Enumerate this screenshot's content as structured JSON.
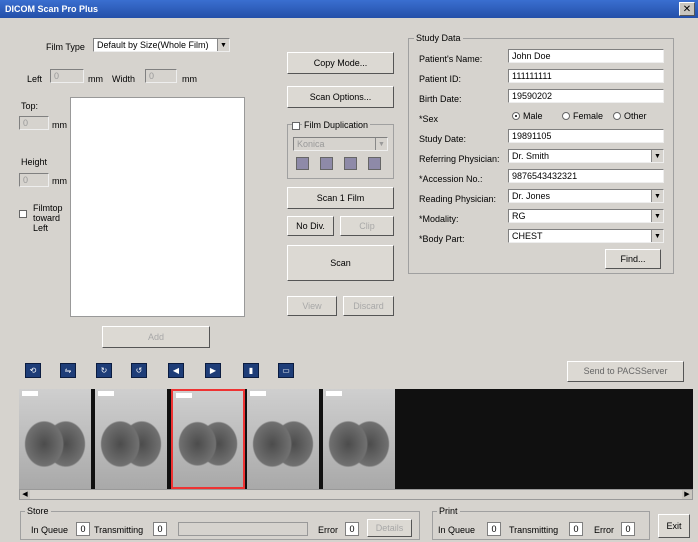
{
  "window": {
    "title": "DICOM Scan Pro Plus",
    "close_glyph": "✕"
  },
  "scan": {
    "film_type_label": "Film Type",
    "film_type_value": "Default by Size(Whole Film)",
    "left_label": "Left",
    "left_value": "0",
    "mm1": "mm",
    "width_label": "Width",
    "width_value": "0",
    "mm2": "mm",
    "top_label": "Top:",
    "top_value": "0",
    "mm3": "mm",
    "height_label": "Height",
    "height_value": "0",
    "mm4": "mm",
    "filmtop_label_1": "Filmtop",
    "filmtop_label_2": "toward",
    "filmtop_label_3": "Left",
    "add_label": "Add"
  },
  "middle": {
    "copy_mode": "Copy Mode...",
    "scan_options": "Scan Options...",
    "film_dup_label": "Film Duplication",
    "film_dup_combo": "Konica",
    "scan_1_film": "Scan 1 Film",
    "no_div": "No Div.",
    "clip": "Clip",
    "scan": "Scan",
    "view": "View",
    "discard": "Discard"
  },
  "study": {
    "group_label": "Study Data",
    "patient_name_label": "Patient's Name:",
    "patient_name": "John Doe",
    "patient_id_label": "Patient ID:",
    "patient_id": "111111111",
    "birth_date_label": "Birth Date:",
    "birth_date": "19590202",
    "sex_label": "*Sex",
    "male": "Male",
    "female": "Female",
    "other": "Other",
    "study_date_label": "Study Date:",
    "study_date": "19891105",
    "ref_phys_label": "Referring Physician:",
    "ref_phys": "Dr. Smith",
    "accession_label": "*Accession No.:",
    "accession": "9876543432321",
    "read_phys_label": "Reading Physician:",
    "read_phys": "Dr. Jones",
    "modality_label": "*Modality:",
    "modality": "RG",
    "body_part_label": "*Body Part:",
    "body_part": "CHEST",
    "find": "Find..."
  },
  "toolbar": {
    "tools": [
      "rotate-icon",
      "mirror-icon",
      "rotate-cw-icon",
      "rotate-ccw-icon",
      "arrow-left-icon",
      "arrow-right-icon",
      "delete-icon",
      "invert-icon"
    ],
    "send_pacs": "Send to PACSServer"
  },
  "thumbnails": {
    "count": 5,
    "selected_index": 2
  },
  "store": {
    "group_label": "Store",
    "in_queue_label": "In Queue",
    "in_queue": "0",
    "transmitting_label": "Transmitting",
    "transmitting": "0",
    "error_label": "Error",
    "error": "0",
    "details": "Details"
  },
  "print": {
    "group_label": "Print",
    "in_queue_label": "In Queue",
    "in_queue": "0",
    "transmitting_label": "Transmitting",
    "transmitting": "0",
    "error_label": "Error",
    "error": "0"
  },
  "exit": "Exit"
}
